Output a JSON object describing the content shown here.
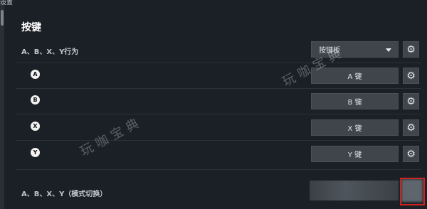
{
  "header": {
    "crumb": "设置"
  },
  "section": {
    "title": "按键"
  },
  "rows": {
    "abxy_behavior": {
      "label": "A、B、X、Y行为",
      "select_value": "按键板"
    },
    "a": {
      "glyph": "A",
      "button_label": "A 键"
    },
    "b": {
      "glyph": "B",
      "button_label": "B 键"
    },
    "x": {
      "glyph": "X",
      "button_label": "X 键"
    },
    "y": {
      "glyph": "Y",
      "button_label": "Y 键"
    },
    "mode_toggle": {
      "label": "A、B、X、Y（模式切换）"
    }
  },
  "watermark": {
    "text": "玩咖宝典"
  },
  "icons": {
    "settings": "gear-icon",
    "dropdown": "chevron-down-icon"
  }
}
